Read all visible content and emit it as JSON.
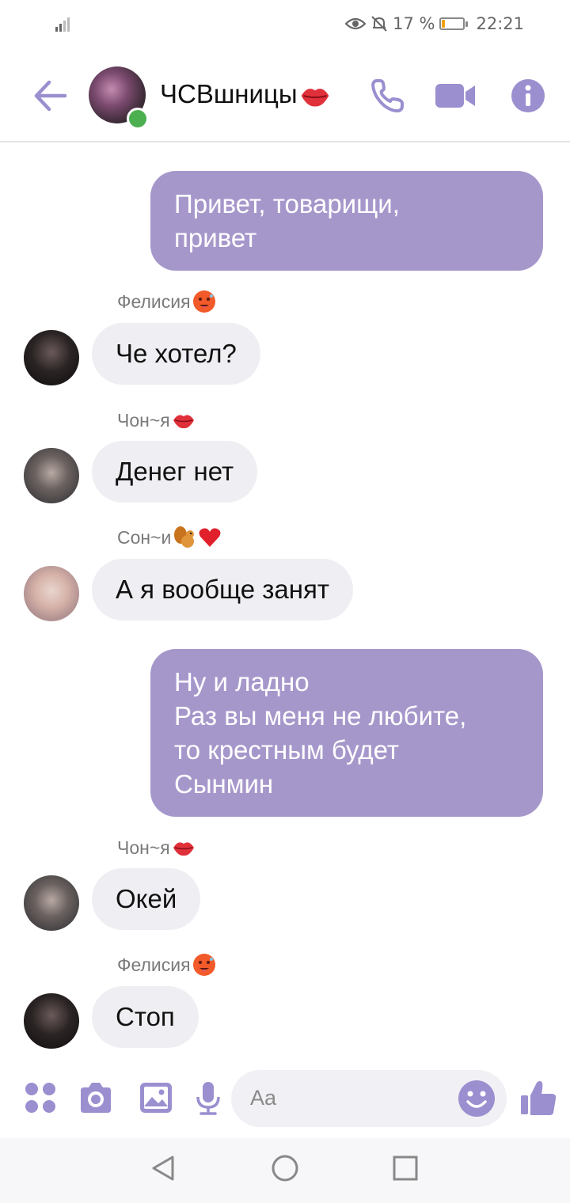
{
  "status_bar": {
    "battery_percent": "17 %",
    "battery_level": 0.17,
    "time": "22:21"
  },
  "header": {
    "title": "ЧСВшницы"
  },
  "messages": [
    {
      "type": "outgoing",
      "lines": [
        "Привет, товарищи,",
        "привет"
      ]
    },
    {
      "type": "incoming",
      "sender": "Фелисия",
      "text": "Че хотел?"
    },
    {
      "type": "incoming",
      "sender": "Чон~я",
      "text": "Денег нет"
    },
    {
      "type": "incoming",
      "sender": "Сон~и",
      "text": "А я вообще занят"
    },
    {
      "type": "outgoing",
      "lines": [
        "Ну и ладно",
        "Раз вы меня не любите,",
        "то крестным будет",
        "Сынмин"
      ]
    },
    {
      "type": "incoming",
      "sender": "Чон~я",
      "text": "Окей"
    },
    {
      "type": "incoming",
      "sender": "Фелисия",
      "text": "Стоп"
    }
  ],
  "composer": {
    "placeholder": "Aa"
  },
  "colors": {
    "accent": "#a697cb",
    "icon": "#9b8fd0",
    "incoming_bubble": "#efeef2",
    "online": "#4caf50"
  }
}
